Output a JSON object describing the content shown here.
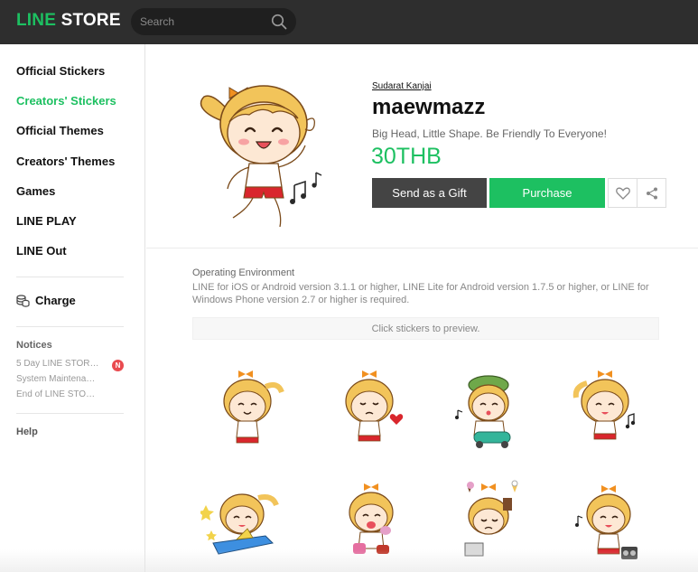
{
  "header": {
    "logo_line": "LINE",
    "logo_store": "STORE",
    "search_placeholder": "Search",
    "search_icon": "search-icon"
  },
  "sidebar": {
    "items": [
      {
        "label": "Official Stickers",
        "active": false
      },
      {
        "label": "Creators' Stickers",
        "active": true
      },
      {
        "label": "Official Themes",
        "active": false
      },
      {
        "label": "Creators' Themes",
        "active": false
      },
      {
        "label": "Games",
        "active": false
      },
      {
        "label": "LINE PLAY",
        "active": false
      },
      {
        "label": "LINE Out",
        "active": false
      }
    ],
    "charge_label": "Charge",
    "charge_icon": "coins-icon",
    "notices_title": "Notices",
    "notices": [
      "5 Day LINE STOR…",
      "System Maintena…",
      "End of LINE STO…"
    ],
    "notice_badge": "N",
    "help_label": "Help"
  },
  "product": {
    "creator": "Sudarat Kanjai",
    "title": "maewmazz",
    "description": "Big Head, Little Shape. Be Friendly To Everyone!",
    "price": "30THB",
    "gift_button": "Send as a Gift",
    "purchase_button": "Purchase",
    "favorite_icon": "heart-icon",
    "share_icon": "share-icon"
  },
  "environment": {
    "label": "Operating Environment",
    "text": "LINE for iOS or Android version 3.1.1 or higher, LINE Lite for Android version 1.7.5 or higher, or LINE for Windows Phone version 2.7 or higher is required."
  },
  "preview_hint": "Click stickers to preview.",
  "colors": {
    "brand_green": "#1dc061",
    "header_bg": "#2e2e2e",
    "gift_button_bg": "#444444",
    "badge_red": "#e94a4f"
  }
}
